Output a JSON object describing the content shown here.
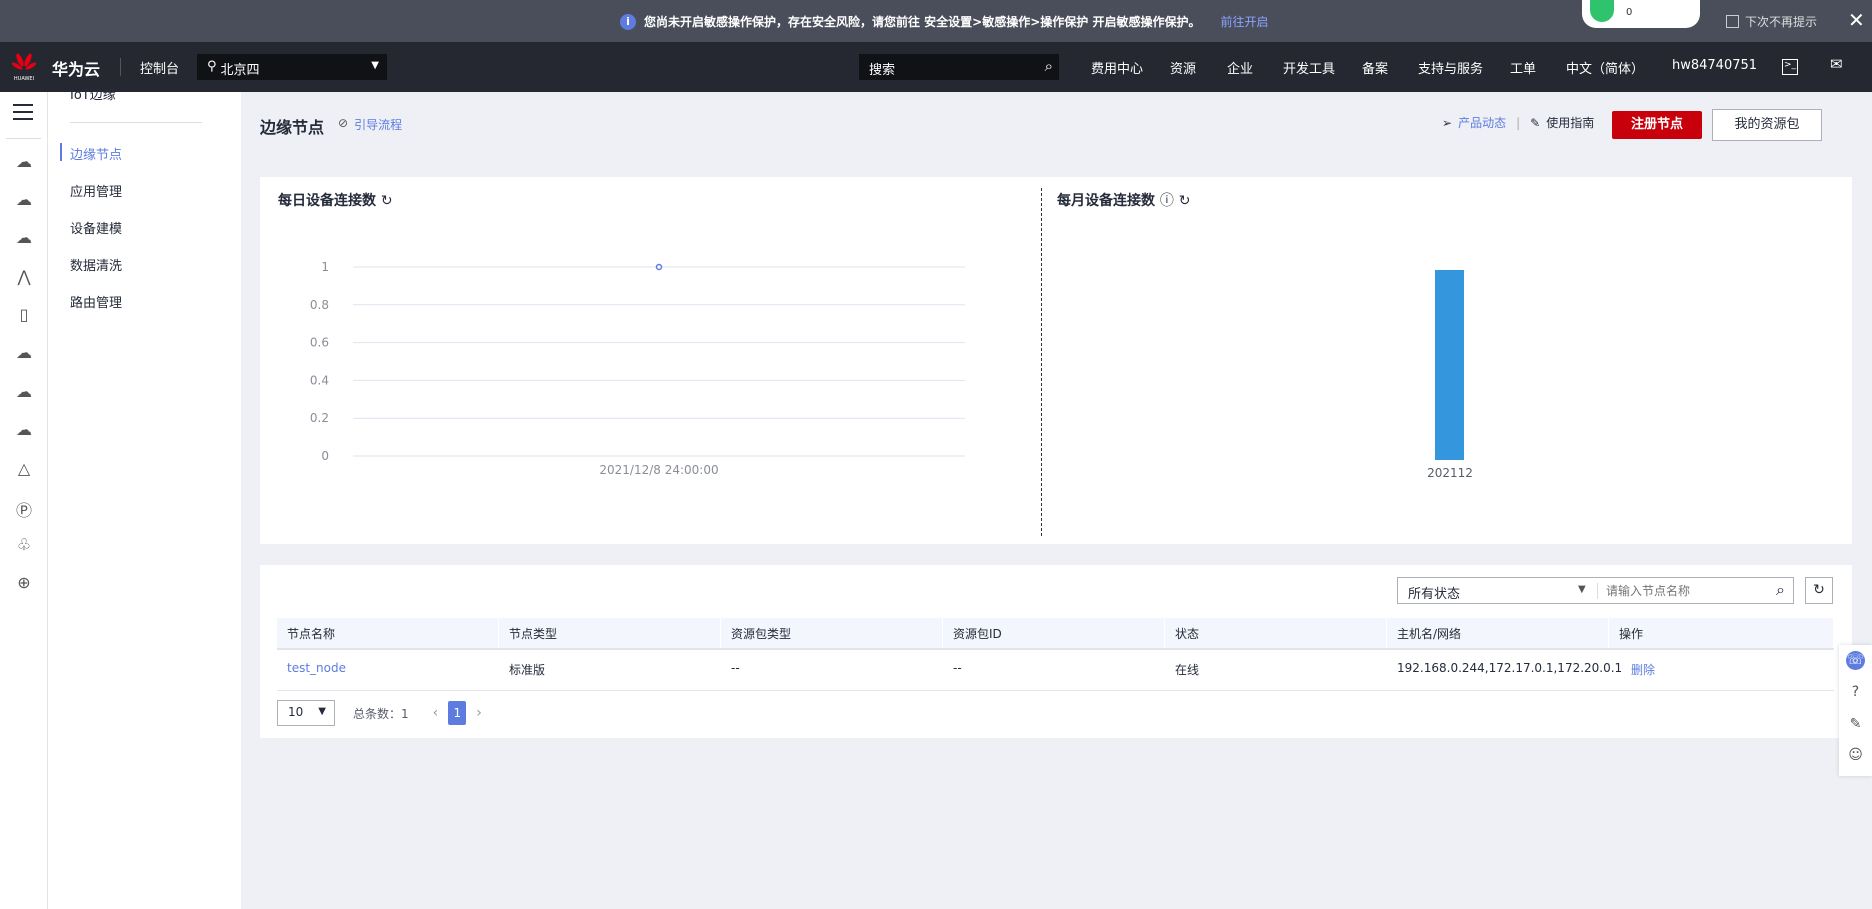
{
  "banner": {
    "message": "您尚未开启敏感操作保护，存在安全风险，请您前往 安全设置>敏感操作>操作保护 开启敏感操作保护。",
    "link": "前往开启",
    "dont_show": "下次不再提示",
    "wifi_count": "0"
  },
  "header": {
    "brand": "华为云",
    "logo_text": "HUAWEI",
    "console": "控制台",
    "region": "北京四",
    "search_placeholder": "搜索",
    "nav": [
      "费用中心",
      "资源",
      "企业",
      "开发工具",
      "备案",
      "支持与服务",
      "工单",
      "中文（简体）",
      "hw84740751"
    ]
  },
  "submenu": {
    "top": "IoT边缘",
    "items": [
      "边缘节点",
      "应用管理",
      "设备建模",
      "数据清洗",
      "路由管理"
    ]
  },
  "page": {
    "title": "边缘节点",
    "guide": "引导流程",
    "product_news": "产品动态",
    "user_guide": "使用指南",
    "register": "注册节点",
    "my_packages": "我的资源包"
  },
  "colors": {
    "accent": "#5e7ce0",
    "primary_button": "#c7000b",
    "bar": "#3497dd"
  },
  "chart_data": [
    {
      "type": "line",
      "title": "每日设备连接数",
      "x": [
        "2021/12/8 24:00:00"
      ],
      "values": [
        1
      ],
      "yticks": [
        "0",
        "0.2",
        "0.4",
        "0.6",
        "0.8",
        "1"
      ],
      "ylim": [
        0,
        1
      ],
      "grid": true
    },
    {
      "type": "bar",
      "title": "每月设备连接数",
      "categories": [
        "202112"
      ],
      "values": [
        1
      ],
      "ylim": [
        0,
        1
      ],
      "grid": false
    }
  ],
  "table": {
    "filter": "所有状态",
    "search_placeholder": "请输入节点名称",
    "columns": [
      "节点名称",
      "节点类型",
      "资源包类型",
      "资源包ID",
      "状态",
      "主机名/网络",
      "操作"
    ],
    "rows": [
      [
        "test_node",
        "标准版",
        "--",
        "--",
        "在线",
        "192.168.0.244,172.17.0.1,172.20.0.1",
        "删除"
      ]
    ],
    "page_size": "10",
    "total_label": "总条数：",
    "total": "1",
    "current_page": "1"
  }
}
